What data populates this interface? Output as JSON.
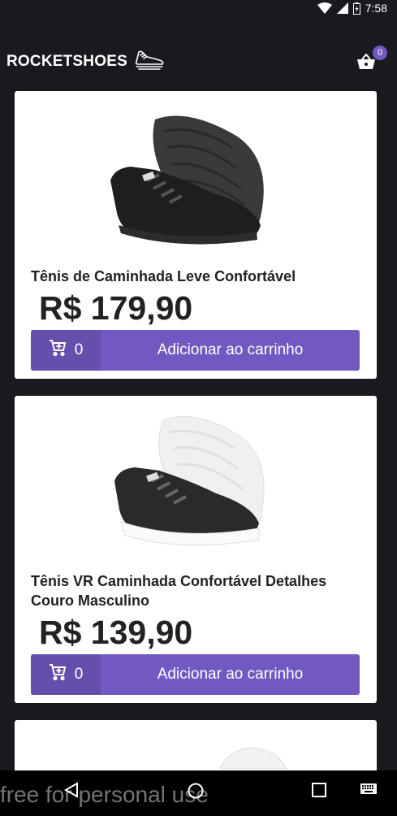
{
  "status_bar": {
    "time": "7:58"
  },
  "header": {
    "logo_text": "ROCKETSHOES",
    "cart_count": "0"
  },
  "products": [
    {
      "title": "Tênis de Caminhada Leve Confortável",
      "price": "R$ 179,90",
      "amount": "0",
      "button_label": "Adicionar ao carrinho"
    },
    {
      "title": " Tênis VR Caminhada Confortável Detalhes Couro Masculino",
      "price": "R$ 139,90",
      "amount": "0",
      "button_label": "Adicionar ao carrinho"
    }
  ],
  "watermark": "free for personal use",
  "colors": {
    "background": "#191920",
    "accent": "#7159c1",
    "card": "#ffffff"
  },
  "icons": [
    "wifi-icon",
    "signal-icon",
    "battery-icon",
    "sneaker-logo-icon",
    "basket-icon",
    "add-cart-icon",
    "back-nav-icon",
    "home-nav-icon",
    "recents-nav-icon",
    "keyboard-icon"
  ]
}
